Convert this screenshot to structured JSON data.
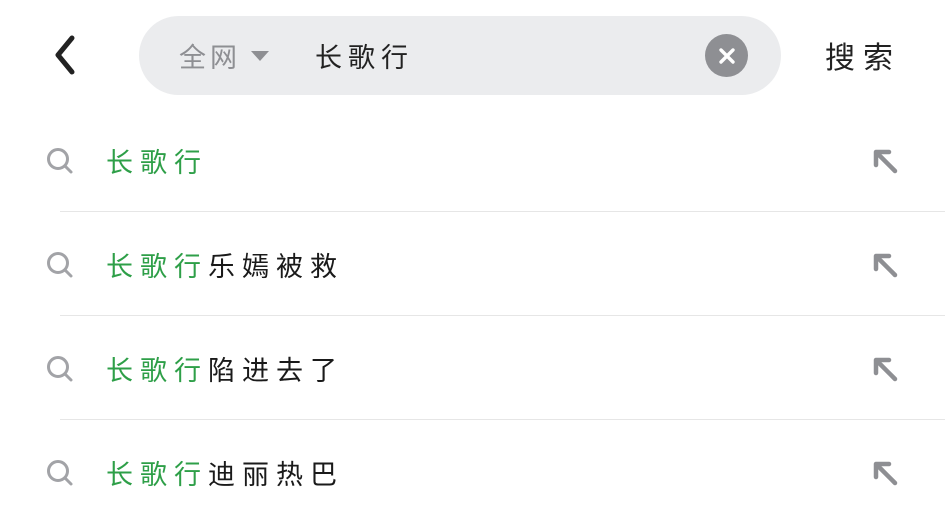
{
  "search": {
    "scope_label": "全网",
    "query": "长歌行",
    "submit_label": "搜索"
  },
  "icons": {
    "back": "chevron-left-icon",
    "scope_dropdown": "caret-down-icon",
    "clear": "clear-circle-icon",
    "suggestion_search": "search-icon",
    "fill_query": "arrow-up-left-icon"
  },
  "colors": {
    "highlight": "#2e9f48",
    "search_box_bg": "#ebecee",
    "icon_gray": "#8e8f93",
    "text": "#1a1a1a"
  },
  "suggestions": [
    {
      "highlight": "长歌行",
      "rest": ""
    },
    {
      "highlight": "长歌行",
      "rest": "乐嫣被救"
    },
    {
      "highlight": "长歌行",
      "rest": "陷进去了"
    },
    {
      "highlight": "长歌行",
      "rest": "迪丽热巴"
    }
  ]
}
